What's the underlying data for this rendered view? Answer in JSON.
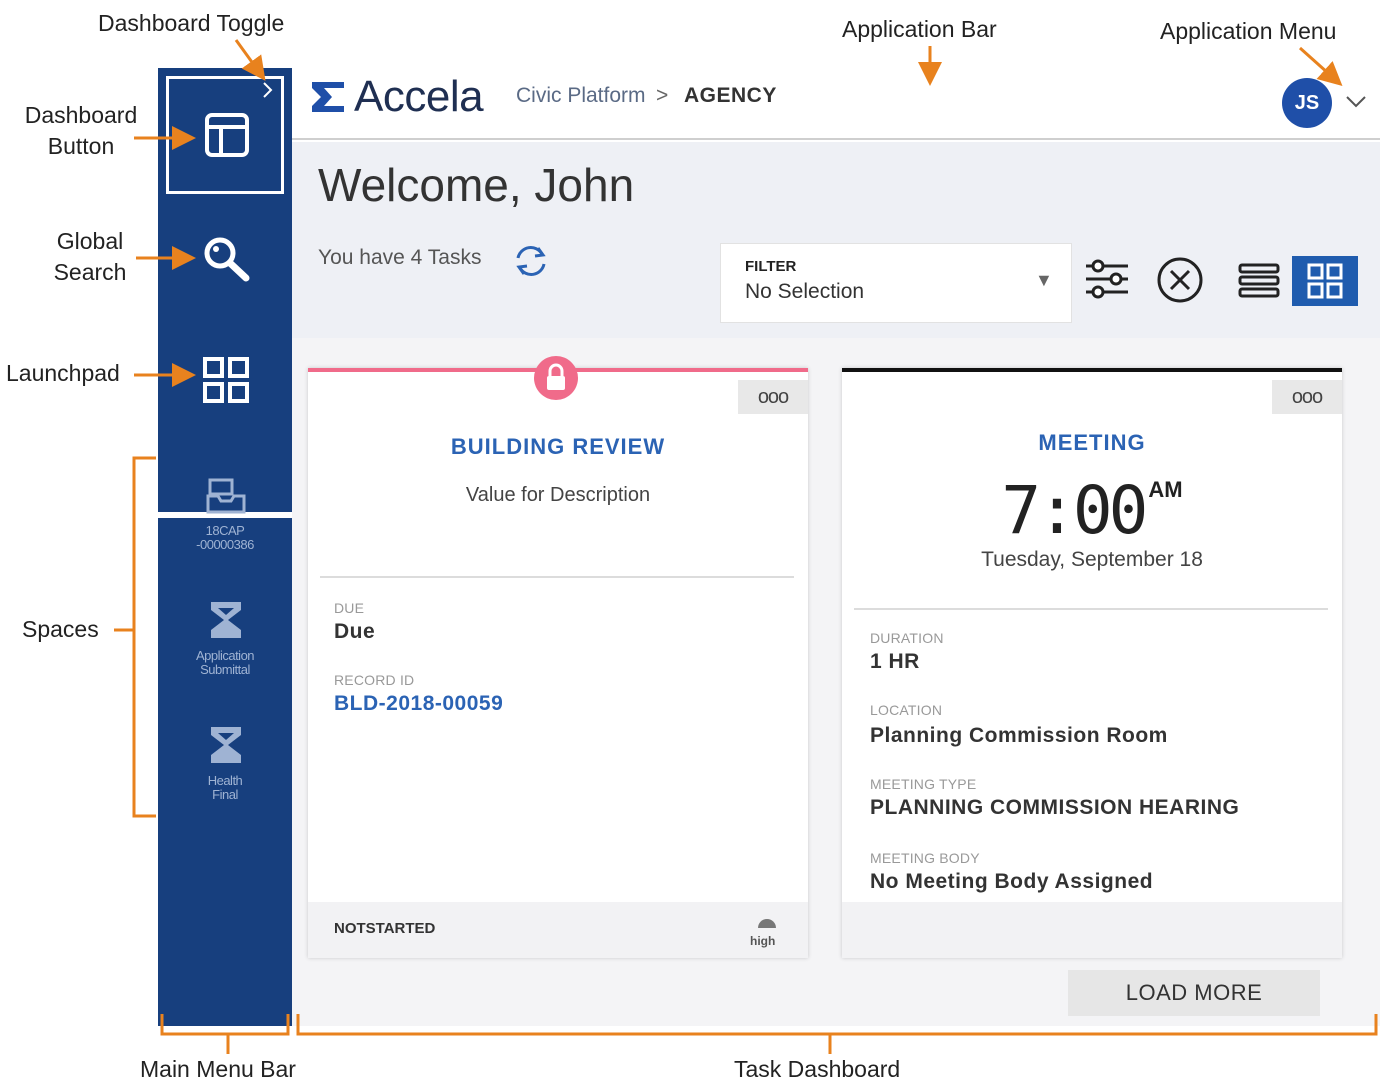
{
  "annotations": {
    "dashboard_toggle": "Dashboard Toggle",
    "application_bar": "Application Bar",
    "application_menu": "Application Menu",
    "dashboard_button_line1": "Dashboard",
    "dashboard_button_line2": "Button",
    "global_search_line1": "Global",
    "global_search_line2": "Search",
    "launchpad": "Launchpad",
    "spaces": "Spaces",
    "main_menu_bar": "Main Menu Bar",
    "task_dashboard": "Task Dashboard",
    "callout_color": "#e8821e"
  },
  "sidebar": {
    "bg_color": "#173f7e",
    "icons": [
      "dashboard-icon",
      "search-icon",
      "launchpad-icon"
    ],
    "spaces": [
      {
        "icon": "inbox-icon",
        "line1": "18CAP",
        "line2": "-00000386"
      },
      {
        "icon": "hourglass-icon",
        "line1": "Application",
        "line2": "Submittal"
      },
      {
        "icon": "hourglass-icon",
        "line1": "Health",
        "line2": "Final"
      }
    ]
  },
  "appbar": {
    "brand": "Accela",
    "breadcrumb": {
      "platform": "Civic Platform",
      "separator": ">",
      "agency": "AGENCY"
    },
    "user_initials": "JS",
    "accent": "#1f4fa8"
  },
  "dashboard": {
    "welcome": "Welcome, John",
    "tasks_text": "You have 4 Tasks",
    "filter": {
      "label": "FILTER",
      "value": "No Selection"
    },
    "load_more": "LOAD MORE"
  },
  "cards": {
    "building": {
      "more": "ooo",
      "title": "BUILDING REVIEW",
      "description": "Value for Description",
      "due_label": "DUE",
      "due_value": "Due",
      "record_label": "RECORD ID",
      "record_value": "BLD-2018-00059",
      "status": "NOTSTARTED",
      "priority": "high",
      "accent": "#f06b8a"
    },
    "meeting": {
      "more": "ooo",
      "title": "MEETING",
      "time": "7:00",
      "ampm": "AM",
      "date": "Tuesday, September 18",
      "duration_label": "DURATION",
      "duration_value": "1 HR",
      "location_label": "LOCATION",
      "location_value": "Planning Commission Room",
      "type_label": "MEETING TYPE",
      "type_value": "PLANNING COMMISSION HEARING",
      "body_label": "MEETING BODY",
      "body_value": "No Meeting Body Assigned"
    }
  }
}
